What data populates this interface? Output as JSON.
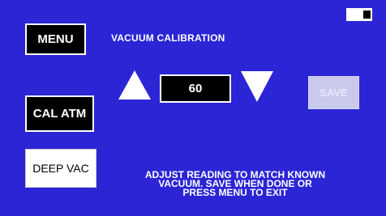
{
  "screen": {
    "title": "VACUUM CALIBRATION",
    "background_color": "#2b25d6"
  },
  "buttons": {
    "menu_label": "MENU",
    "cal_atm_label": "CAL ATM",
    "deep_vac_label": "DEEP VAC",
    "save_label": "SAVE"
  },
  "adjuster": {
    "value": "60",
    "increase_icon": "triangle-up-icon",
    "decrease_icon": "triangle-down-icon"
  },
  "instructions": {
    "line1": "ADJUST READING TO MATCH KNOWN",
    "line2": "VACUUM. SAVE WHEN DONE OR",
    "line3": "PRESS MENU TO EXIT"
  },
  "status": {
    "battery_icon": "battery-icon"
  }
}
